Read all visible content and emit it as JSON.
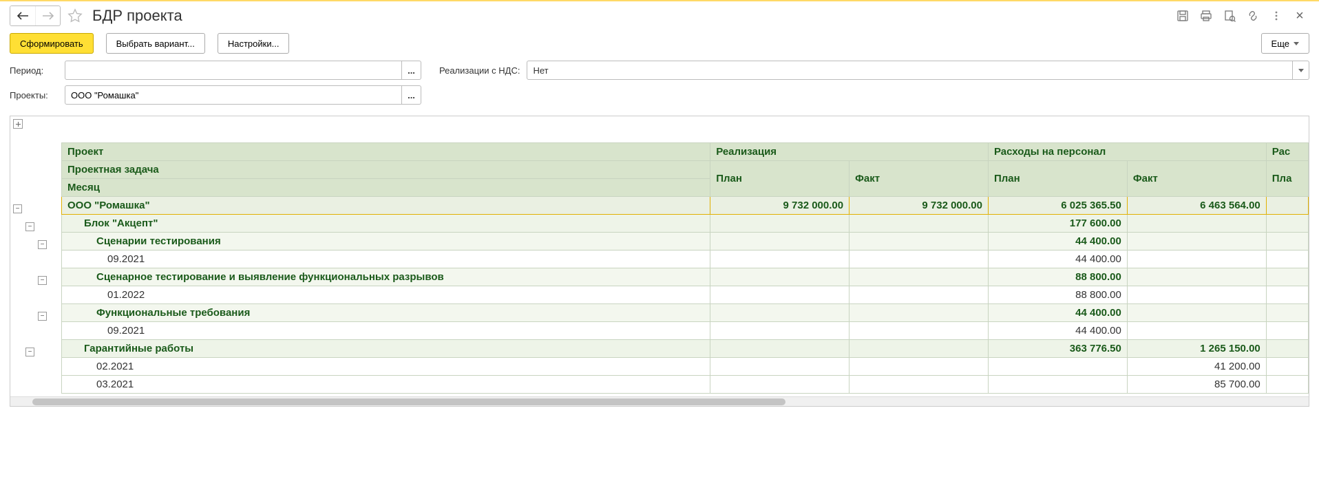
{
  "header": {
    "title": "БДР проекта"
  },
  "toolbar": {
    "form_label": "Сформировать",
    "variant_label": "Выбрать вариант...",
    "settings_label": "Настройки...",
    "more_label": "Еще"
  },
  "filters": {
    "period_label": "Период:",
    "period_value": "",
    "nds_label": "Реализации с НДС:",
    "nds_value": "Нет",
    "projects_label": "Проекты:",
    "projects_value": "ООО \"Ромашка\""
  },
  "columns": {
    "project": "Проект",
    "realization": "Реализация",
    "personnel": "Расходы на персонал",
    "other": "Рас",
    "task": "Проектная задача",
    "month": "Месяц",
    "plan": "План",
    "fact": "Факт",
    "plan2": "Пла"
  },
  "rows": [
    {
      "type": "group-top",
      "indent": 0,
      "label": "ООО \"Ромашка\"",
      "r_plan": "9 732 000.00",
      "r_fact": "9 732 000.00",
      "p_plan": "6 025 365.50",
      "p_fact": "6 463 564.00"
    },
    {
      "type": "task",
      "indent": 1,
      "label": "Блок \"Акцепт\"",
      "r_plan": "",
      "r_fact": "",
      "p_plan": "177 600.00",
      "p_fact": ""
    },
    {
      "type": "subtask",
      "indent": 2,
      "label": "Сценарии тестирования",
      "r_plan": "",
      "r_fact": "",
      "p_plan": "44 400.00",
      "p_fact": ""
    },
    {
      "type": "month",
      "indent": 3,
      "label": "09.2021",
      "r_plan": "",
      "r_fact": "",
      "p_plan": "44 400.00",
      "p_fact": ""
    },
    {
      "type": "subtask",
      "indent": 2,
      "label": "Сценарное тестирование и выявление функциональных разрывов",
      "r_plan": "",
      "r_fact": "",
      "p_plan": "88 800.00",
      "p_fact": ""
    },
    {
      "type": "month",
      "indent": 3,
      "label": "01.2022",
      "r_plan": "",
      "r_fact": "",
      "p_plan": "88 800.00",
      "p_fact": ""
    },
    {
      "type": "subtask",
      "indent": 2,
      "label": "Функциональные требования",
      "r_plan": "",
      "r_fact": "",
      "p_plan": "44 400.00",
      "p_fact": ""
    },
    {
      "type": "month",
      "indent": 3,
      "label": "09.2021",
      "r_plan": "",
      "r_fact": "",
      "p_plan": "44 400.00",
      "p_fact": ""
    },
    {
      "type": "task",
      "indent": 1,
      "label": "Гарантийные работы",
      "r_plan": "",
      "r_fact": "",
      "p_plan": "363 776.50",
      "p_fact": "1 265 150.00"
    },
    {
      "type": "month",
      "indent": 2,
      "label": "02.2021",
      "r_plan": "",
      "r_fact": "",
      "p_plan": "",
      "p_fact": "41 200.00"
    },
    {
      "type": "month",
      "indent": 2,
      "label": "03.2021",
      "r_plan": "",
      "r_fact": "",
      "p_plan": "",
      "p_fact": "85 700.00"
    }
  ]
}
